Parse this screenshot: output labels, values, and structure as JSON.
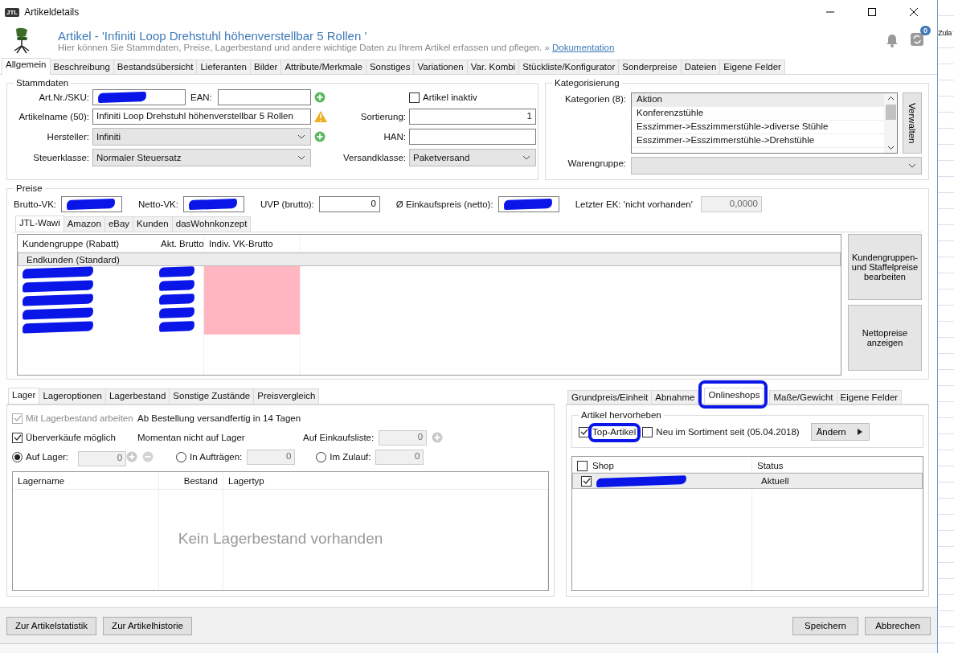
{
  "window": {
    "logo": "JTL",
    "title": "Artikeldetails"
  },
  "header": {
    "title": "Artikel - 'Infiniti Loop Drehstuhl höhenverstellbar 5 Rollen '",
    "subtitle": "Hier können Sie Stammdaten, Preise, Lagerbestand und andere wichtige Daten zu Ihrem Artikel erfassen und pflegen. »",
    "link": "Dokumentation",
    "badge": "0"
  },
  "tabs": [
    {
      "label": "Allgemein",
      "selected": true
    },
    {
      "label": "Beschreibung",
      "selected": false
    },
    {
      "label": "Bestandsübersicht",
      "selected": false
    },
    {
      "label": "Lieferanten",
      "selected": false
    },
    {
      "label": "Bilder",
      "selected": false
    },
    {
      "label": "Attribute/Merkmale",
      "selected": false
    },
    {
      "label": "Sonstiges",
      "selected": false
    },
    {
      "label": "Variationen",
      "selected": false
    },
    {
      "label": "Var. Kombi",
      "selected": false
    },
    {
      "label": "Stückliste/Konfigurator",
      "selected": false
    },
    {
      "label": "Sonderpreise",
      "selected": false
    },
    {
      "label": "Dateien",
      "selected": false
    },
    {
      "label": "Eigene Felder",
      "selected": false
    }
  ],
  "stammdaten": {
    "title": "Stammdaten",
    "sku": {
      "label": "Art.Nr./SKU:",
      "redacted": true
    },
    "ean": {
      "label": "EAN:"
    },
    "inactive": {
      "label": "Artikel inaktiv",
      "checked": false
    },
    "name": {
      "label": "Artikelname (50):",
      "value": "Infiniti Loop Drehstuhl höhenverstellbar 5 Rollen",
      "warning": true
    },
    "sort": {
      "label": "Sortierung:",
      "value": "1"
    },
    "manufacturer": {
      "label": "Hersteller:",
      "value": "Infiniti"
    },
    "han": {
      "label": "HAN:"
    },
    "tax": {
      "label": "Steuerklasse:",
      "value": "Normaler Steuersatz"
    },
    "shipping": {
      "label": "Versandklasse:",
      "value": "Paketversand"
    }
  },
  "kategorisierung": {
    "title": "Kategorisierung",
    "label": "Kategorien (8):",
    "items": [
      {
        "name": "Aktion",
        "selected": true
      },
      {
        "name": "Konferenzstühle",
        "selected": false
      },
      {
        "name": "Esszimmer->Esszimmerstühle->diverse Stühle",
        "selected": false
      },
      {
        "name": "Esszimmer->Esszimmerstühle->Drehstühle",
        "selected": false
      }
    ],
    "button": "Verwalten",
    "group_label": "Warengruppe:"
  },
  "preise": {
    "title": "Preise",
    "fields": [
      {
        "label": "Brutto-VK:",
        "redacted": true
      },
      {
        "label": "Netto-VK:",
        "redacted": true
      },
      {
        "label": "UVP (brutto):",
        "value": "0"
      },
      {
        "label": "Ø Einkaufspreis (netto):",
        "redacted": true
      }
    ],
    "last_ek": {
      "label": "Letzter EK: 'nicht vorhanden'",
      "value": "0,0000"
    },
    "tabs": [
      {
        "label": "JTL-Wawi",
        "selected": true
      },
      {
        "label": "Amazon",
        "selected": false
      },
      {
        "label": "eBay",
        "selected": false
      },
      {
        "label": "Kunden",
        "selected": false
      },
      {
        "label": "dasWohnkonzept",
        "selected": false
      }
    ],
    "table": {
      "columns": [
        "Kundengruppe (Rabatt)",
        "Akt. Brutto",
        "Indiv. VK-Brutto"
      ],
      "rows": [
        {
          "name": "Endkunden (Standard)",
          "selected": true,
          "redacted": false,
          "highlighted": false
        },
        {
          "selected": false,
          "redacted": true,
          "highlighted": true
        },
        {
          "selected": false,
          "redacted": true,
          "highlighted": true
        },
        {
          "selected": false,
          "redacted": true,
          "highlighted": true
        },
        {
          "selected": false,
          "redacted": true,
          "highlighted": true
        },
        {
          "selected": false,
          "redacted": true,
          "highlighted": true
        }
      ]
    },
    "buttons": [
      "Kundengruppen- und Staffelpreise bearbeiten",
      "Nettopreise anzeigen"
    ]
  },
  "lager": {
    "tabs": [
      {
        "label": "Lager",
        "selected": true
      },
      {
        "label": "Lageroptionen",
        "selected": false
      },
      {
        "label": "Lagerbestand",
        "selected": false
      },
      {
        "label": "Sonstige Zustände",
        "selected": false
      },
      {
        "label": "Preisvergleich",
        "selected": false
      }
    ],
    "work_with_stock": {
      "label": "Mit Lagerbestand arbeiten",
      "checked": true,
      "disabled": true
    },
    "delivery_note": "Ab Bestellung versandfertig in 14 Tagen",
    "oversell": {
      "label": "Überverkäufe möglich",
      "checked": true,
      "disabled": false
    },
    "stock_note": "Momentan nicht auf Lager",
    "purchase_list": {
      "label": "Auf Einkaufsliste:",
      "value": "0"
    },
    "radios": [
      {
        "label": "Auf Lager:",
        "value": "0",
        "selected": true
      },
      {
        "label": "In Aufträgen:",
        "value": "0",
        "selected": false
      },
      {
        "label": "Im Zulauf:",
        "value": "0",
        "selected": false
      }
    ],
    "table": {
      "columns": [
        "Lagername",
        "Bestand",
        "Lagertyp"
      ],
      "empty_text": "Kein Lagerbestand vorhanden"
    }
  },
  "shops": {
    "tabs": [
      {
        "label": "Grundpreis/Einheit",
        "selected": false
      },
      {
        "label": "Abnahme",
        "selected": false
      },
      {
        "label": "Onlineshops",
        "selected": true
      },
      {
        "label": "Maße/Gewicht",
        "selected": false
      },
      {
        "label": "Eigene Felder",
        "selected": false
      }
    ],
    "highlight": {
      "title": "Artikel hervorheben",
      "top": {
        "label": "Top-Artikel",
        "checked": true
      },
      "new": {
        "label": "Neu im Sortiment seit (05.04.2018)",
        "checked": false
      },
      "button": "Ändern"
    },
    "table": {
      "all_checked": false,
      "columns": [
        "Shop",
        "Status"
      ],
      "rows": [
        {
          "checked": true,
          "redacted": true,
          "status": "Aktuell",
          "selected": true
        }
      ]
    }
  },
  "footer": {
    "left": [
      "Zur Artikelstatistik",
      "Zur Artikelhistorie"
    ],
    "right": [
      "Speichern",
      "Abbrechen"
    ]
  },
  "background": {
    "side_text": "Zula"
  }
}
